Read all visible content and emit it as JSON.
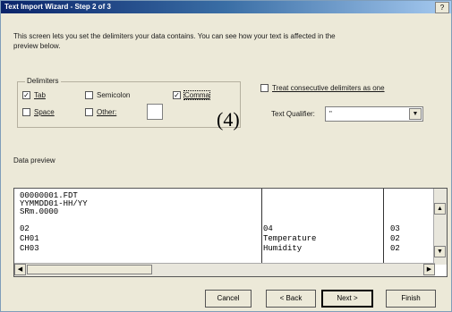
{
  "window": {
    "title": "Text Import Wizard - Step 2 of 3",
    "help_label": "?"
  },
  "description": "This screen lets you set the delimiters your data contains. You can see how your text is affected in the preview below.",
  "delimiters": {
    "legend": "Delimiters",
    "tab": {
      "label": "Tab",
      "checked": true
    },
    "semicolon": {
      "label": "Semicolon",
      "checked": false
    },
    "comma": {
      "label": "Comma",
      "checked": true
    },
    "space": {
      "label": "Space",
      "checked": false
    },
    "other": {
      "label": "Other:",
      "checked": false,
      "value": ""
    }
  },
  "consecutive": {
    "label": "Treat consecutive delimiters as one",
    "checked": false
  },
  "text_qualifier": {
    "label": "Text Qualifier:",
    "value": "\""
  },
  "annotation": "(4)",
  "preview": {
    "label": "Data preview",
    "rows": [
      [
        "00000001.FDT",
        "",
        ""
      ],
      [
        "YYMMDD01-HH/YY",
        "",
        ""
      ],
      [
        "SRm.0000",
        "",
        ""
      ],
      [
        "02",
        "04",
        "03"
      ],
      [
        "CH01",
        "Temperature",
        "02"
      ],
      [
        "CH03",
        "Humidity",
        "02"
      ]
    ]
  },
  "buttons": {
    "cancel": "Cancel",
    "back": "< Back",
    "next": "Next >",
    "finish": "Finish"
  },
  "icons": {
    "scroll_up": "▲",
    "scroll_down": "▼",
    "scroll_left": "◀",
    "scroll_right": "▶",
    "dropdown": "▼",
    "check": "✓"
  }
}
